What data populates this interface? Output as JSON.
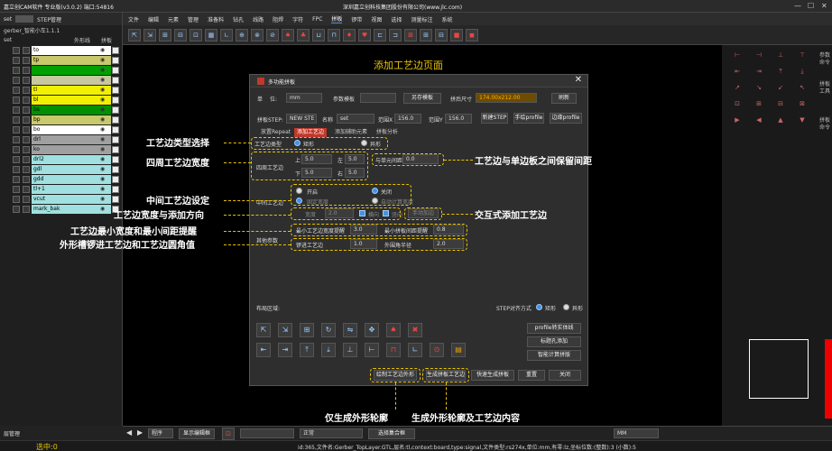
{
  "app": {
    "title": "嘉立创CAM软件 专业版(v3.0.2) 端口:54816",
    "company": "深圳嘉立创科技集团股份有限公司(www.jlc.com)",
    "window_controls": [
      "—",
      "☐",
      "✕"
    ]
  },
  "menu": [
    "文件",
    "编辑",
    "元素",
    "管理",
    "准备料",
    "钻孔",
    "线路",
    "阻焊",
    "字符",
    "FPC",
    "拼板",
    "锣带",
    "视图",
    "选择",
    "测量标注",
    "系统"
  ],
  "menu_active": "拼板",
  "left": {
    "tabs": [
      "set",
      "STEP管理"
    ],
    "job": "gerber_智能小车1.1.1",
    "header": {
      "name": "set",
      "outer": "外形线",
      "panel": "拼板"
    },
    "layers": [
      {
        "name": "to",
        "color": "#ffffff"
      },
      {
        "name": "tp",
        "color": "#c8c86c"
      },
      {
        "name": "",
        "color": "#00a000"
      },
      {
        "name": "",
        "color": "#c8c8a0"
      },
      {
        "name": "tl",
        "color": "#f0f000"
      },
      {
        "name": "bl",
        "color": "#f0f000"
      },
      {
        "name": "bs",
        "color": "#009000"
      },
      {
        "name": "bp",
        "color": "#c8c86c"
      },
      {
        "name": "bo",
        "color": "#ffffff"
      },
      {
        "name": "drl",
        "color": "#a0a0a0"
      },
      {
        "name": "ko",
        "color": "#a0a0a0"
      },
      {
        "name": "drl2",
        "color": "#a0e0e0"
      },
      {
        "name": "gdl",
        "color": "#a0e0e0"
      },
      {
        "name": "gdd",
        "color": "#a0e0e0"
      },
      {
        "name": "tl+1",
        "color": "#a0e0e0"
      },
      {
        "name": "vcut",
        "color": "#a0e0e0"
      },
      {
        "name": "mark_bak",
        "color": "#a0e0e0"
      }
    ]
  },
  "canvas_title": "添加工艺边页面",
  "dialog": {
    "title": "多功能拼板",
    "row1": {
      "unit_label": "单",
      "unit_sep": "位:",
      "unit": "mm",
      "param_label": "参数模板",
      "save_tpl": "另存模板",
      "size_label": "拼后尺寸",
      "size_value": "174.00x212.00",
      "refresh": "刷新"
    },
    "row2": {
      "step_label": "拼板STEP:",
      "step_value": "NEW STE",
      "name_label": "名称",
      "name_value": "set",
      "range_x_label": "范围X",
      "range_x": "156.0",
      "range_y_label": "范围Y",
      "range_y": "156.0",
      "new_step": "新建STEP",
      "manual_profile": "手绘profile",
      "edit_profile": "边缘profile"
    },
    "tabs": [
      "放置Repeat",
      "添加工艺边",
      "添加辅助元素",
      "拼板分析"
    ],
    "tab_active": 1,
    "type_label": "工艺边类型",
    "type_options": [
      "矩形",
      "异形"
    ],
    "four_label": "四周工艺边",
    "up_label": "上",
    "up": "5.0",
    "left_label": "左",
    "left": "5.0",
    "down_label": "下",
    "down": "5.0",
    "right_label": "右",
    "right": "5.0",
    "gap_label": "与单元间距",
    "gap": "0.0",
    "mid_label": "中间工艺边",
    "mid_opts": [
      "开启",
      "关闭",
      "固定宽度",
      "自动计算宽度"
    ],
    "width_label": "宽度",
    "width": "2.0",
    "horiz": "横向",
    "vert": "竖向",
    "interactive": "手动加边",
    "min_width_label": "最小工艺边宽度提醒",
    "min_width": "3.0",
    "min_gap_label": "最小拼板间距提醒",
    "min_gap": "0.8",
    "other_label": "其他参数",
    "mill_label": "锣进工艺边",
    "mill": "1.0",
    "corner_label": "外围角半径",
    "corner": "2.0",
    "align_label": "STEP对齐方式",
    "align_opts": [
      "矩形",
      "异形"
    ],
    "layout_label": "布局区域:",
    "profile_btns": [
      "profile转实体线",
      "标题孔添加",
      "智能计算拼版"
    ],
    "bottom_btns": [
      "绘制工艺边外形",
      "生成拼板工艺边",
      "快速生成拼板",
      "重置",
      "关闭"
    ]
  },
  "annotations": [
    "工艺边类型选择",
    "四周工艺边宽度",
    "中间工艺边设定",
    "工艺边宽度与添加方向",
    "工艺边最小宽度和最小间距提醒",
    "外形槽锣进工艺边和工艺边圆角值",
    "工艺边与单边板之间保留间距",
    "交互式添加工艺边",
    "仅生成外形轮廓",
    "生成外形轮廓及工艺边内容"
  ],
  "right": {
    "side_labels": [
      "参数命令",
      "拼板工具",
      "拼板命令"
    ]
  },
  "bottom": {
    "zoom_mode": "程序",
    "view_btn": "显示编辑框",
    "mode": "正常",
    "select_label": "选择集合框",
    "unit": "MM"
  },
  "leftbottom": {
    "label": "层管理",
    "count_label": "选中:0"
  },
  "status": "id:365,文件名:Gerber_TopLayer.GTL,层名:tl,context:board,type:signal,文件类型:rs274x,单位:mm,有零:lz,坐标位数:(整数):3 (小数):5",
  "colors": {
    "accent": "#c0392b",
    "annotation": "#e9c400",
    "blue": "#4a90e2"
  }
}
